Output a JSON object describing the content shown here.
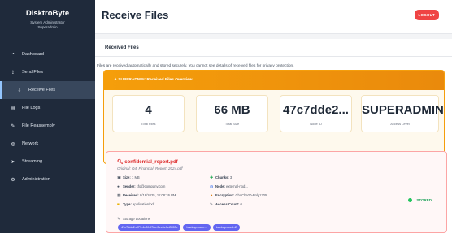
{
  "sidebar": {
    "brand_title": "DisktroByte",
    "brand_subtitle": "System Administrator",
    "brand_role": "Superadmin",
    "items": [
      {
        "label": "Dashboard",
        "icon": "dashboard-icon",
        "glyph": "◔"
      },
      {
        "label": "Send Files",
        "icon": "upload-icon",
        "glyph": "⇪"
      },
      {
        "label": "Receive Files",
        "icon": "download-icon",
        "glyph": "⇩"
      },
      {
        "label": "File Logs",
        "icon": "logs-icon",
        "glyph": "▤"
      },
      {
        "label": "File Reassembly",
        "icon": "puzzle-icon",
        "glyph": "✎"
      },
      {
        "label": "Network",
        "icon": "globe-icon",
        "glyph": "◍"
      },
      {
        "label": "Streaming",
        "icon": "stream-icon",
        "glyph": "➤"
      },
      {
        "label": "Administration",
        "icon": "gear-icon",
        "glyph": "⚙"
      }
    ]
  },
  "header": {
    "title": "Receive Files",
    "logout_label": "LOGOUT"
  },
  "panel": {
    "title": "Received Files",
    "info": "Files are received automatically and stored securely. You cannot see details of received files for privacy protection.",
    "overview_title": "SUPERADMIN: Received Files Overview",
    "stats": [
      {
        "value": "4",
        "label": "Total Files"
      },
      {
        "value": "66 MB",
        "label": "Total Size"
      },
      {
        "value": "47c7dde2...",
        "label": "Node ID"
      },
      {
        "value": "SUPERADMIN",
        "label": "Access Level"
      }
    ]
  },
  "file": {
    "name": "confidential_report.pdf",
    "original": "Original: Q4_Financial_Report_2024.pdf",
    "size_label": "Size:",
    "size": "1 MB",
    "chunks_label": "Chunks:",
    "chunks": "3",
    "sender_label": "Sender:",
    "sender": "cfo@company.com",
    "node_label": "Node:",
    "node": "external-nod...",
    "received_label": "Received:",
    "received": "8/18/2025, 11:08:26 PM",
    "encryption_label": "Encryption:",
    "encryption": "ChaCha20-Poly1305",
    "type_label": "Type:",
    "type": "application/pdf",
    "access_label": "Access Count:",
    "access": "0",
    "status": "STORED",
    "storage_label": "Storage Locations",
    "locations": [
      "47c7dde2-cf79-4d5f-978c-5ec5e1e2b53c",
      "backup-node-1",
      "backup-node-2"
    ]
  },
  "colors": {
    "sidebar_bg": "#1f2a3b",
    "accent_orange": "#f59e0b",
    "danger_red": "#ef4444",
    "pill_indigo": "#6366f1",
    "stored_green": "#22c55e"
  }
}
